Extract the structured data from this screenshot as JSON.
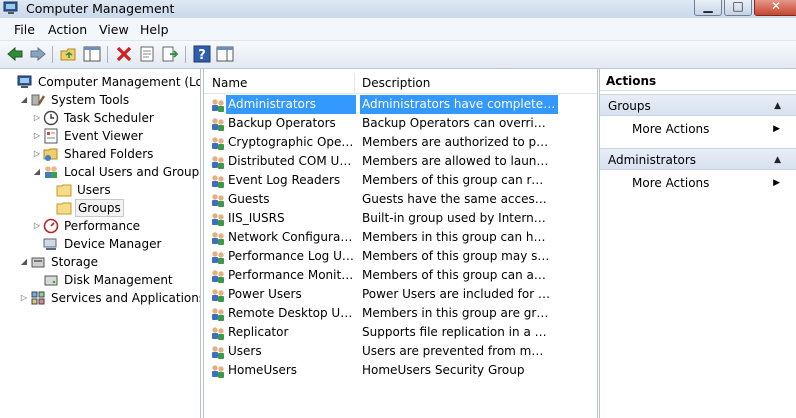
{
  "window": {
    "title": "Computer Management"
  },
  "menu": [
    "File",
    "Action",
    "View",
    "Help"
  ],
  "toolbar": {
    "icons": [
      "back-arrow-icon",
      "forward-arrow-icon",
      "up-folder-icon",
      "show-hide-tree-icon",
      "delete-icon",
      "properties-icon",
      "export-list-icon",
      "help-icon",
      "show-hide-action-pane-icon"
    ]
  },
  "tree": {
    "items": [
      {
        "label": "Computer Management (Local)",
        "icon": "computer-management-icon",
        "expander": "none"
      },
      {
        "label": "System Tools",
        "icon": "system-tools-icon",
        "expander": "expanded"
      },
      {
        "label": "Task Scheduler",
        "icon": "task-scheduler-icon",
        "expander": "collapsed"
      },
      {
        "label": "Event Viewer",
        "icon": "event-viewer-icon",
        "expander": "collapsed"
      },
      {
        "label": "Shared Folders",
        "icon": "shared-folders-icon",
        "expander": "collapsed"
      },
      {
        "label": "Local Users and Groups",
        "icon": "users-groups-icon",
        "expander": "expanded"
      },
      {
        "label": "Users",
        "icon": "folder-icon",
        "expander": "none"
      },
      {
        "label": "Groups",
        "icon": "folder-icon",
        "expander": "none",
        "selected": true
      },
      {
        "label": "Performance",
        "icon": "performance-icon",
        "expander": "collapsed"
      },
      {
        "label": "Device Manager",
        "icon": "device-manager-icon",
        "expander": "none"
      },
      {
        "label": "Storage",
        "icon": "storage-icon",
        "expander": "expanded"
      },
      {
        "label": "Disk Management",
        "icon": "disk-management-icon",
        "expander": "none"
      },
      {
        "label": "Services and Applications",
        "icon": "services-icon",
        "expander": "collapsed"
      }
    ]
  },
  "list": {
    "columns": {
      "name": "Name",
      "description": "Description"
    },
    "rows": [
      {
        "name": "Administrators",
        "description": "Administrators have complete an...",
        "selected": true
      },
      {
        "name": "Backup Operators",
        "description": "Backup Operators can override se..."
      },
      {
        "name": "Cryptographic Operat...",
        "description": "Members are authorized to perfor..."
      },
      {
        "name": "Distributed COM Users",
        "description": "Members are allowed to launch, a..."
      },
      {
        "name": "Event Log Readers",
        "description": "Members of this group can read e..."
      },
      {
        "name": "Guests",
        "description": "Guests have the same access as m..."
      },
      {
        "name": "IIS_IUSRS",
        "description": "Built-in group used by Internet Inf..."
      },
      {
        "name": "Network Configuratio...",
        "description": "Members in this group can have s..."
      },
      {
        "name": "Performance Log Users",
        "description": "Members of this group may sche..."
      },
      {
        "name": "Performance Monitor ...",
        "description": "Members of this group can acces..."
      },
      {
        "name": "Power Users",
        "description": "Power Users are included for back..."
      },
      {
        "name": "Remote Desktop Users",
        "description": "Members in this group are grante..."
      },
      {
        "name": "Replicator",
        "description": "Supports file replication in a dom..."
      },
      {
        "name": "Users",
        "description": "Users are prevented from making ..."
      },
      {
        "name": "HomeUsers",
        "description": "HomeUsers Security Group"
      }
    ]
  },
  "actions": {
    "title": "Actions",
    "sections": [
      {
        "header": "Groups",
        "item": "More Actions"
      },
      {
        "header": "Administrators",
        "item": "More Actions"
      }
    ]
  },
  "colors": {
    "selection": "#3399ff",
    "pane_border": "#b6c2d2",
    "section_header": "#dde6f2"
  }
}
